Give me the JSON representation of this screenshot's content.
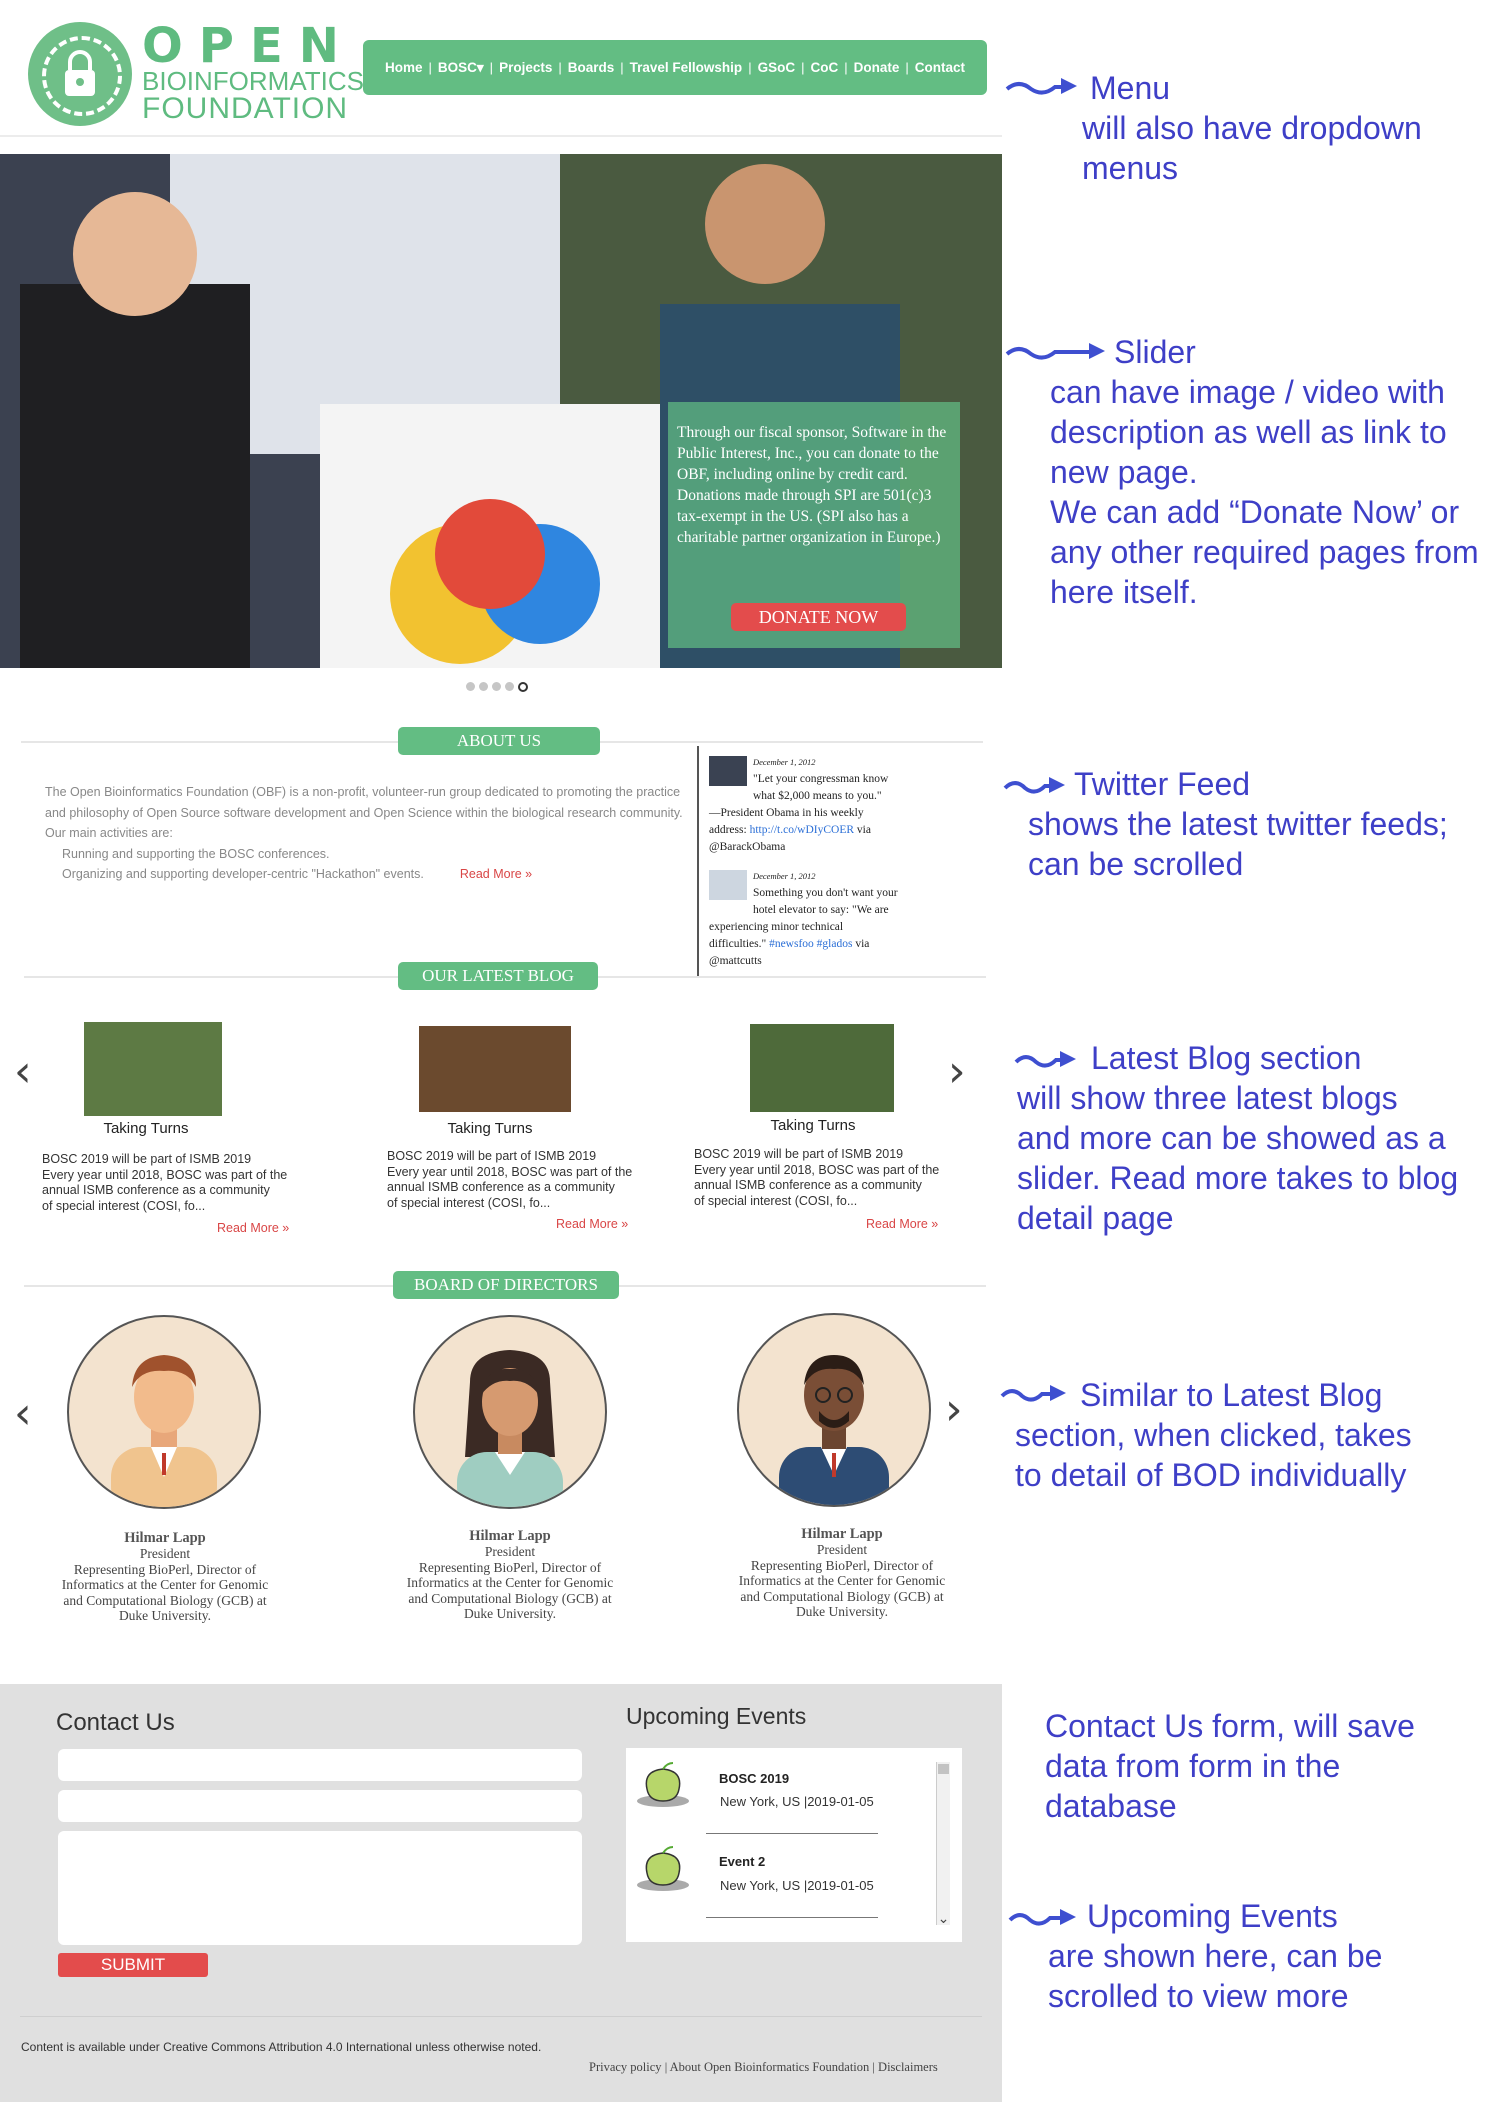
{
  "header": {
    "logo_word": "OPEN",
    "logo_line2": "BIOINFORMATICS",
    "logo_line3": "FOUNDATION",
    "menu": [
      "Home",
      "BOSC",
      "Projects",
      "Boards",
      "Travel Fellowship",
      "GSoC",
      "CoC",
      "Donate",
      "Contact"
    ],
    "menu_dropdown_marker": "▾"
  },
  "slider": {
    "caption": "Through our fiscal sponsor, Software in the Public Interest, Inc., you can donate to the OBF, including online by credit card. Donations made through SPI are 501(c)3 tax-exempt in the US. (SPI also has a charitable partner organization in Europe.)",
    "cta": "DONATE NOW",
    "dot_count": 5,
    "active_dot": 5
  },
  "about": {
    "heading": "ABOUT US",
    "para": "The Open Bioinformatics Foundation (OBF) is a non-profit, volunteer-run group dedicated to promoting the practice and philosophy of Open Source software development and Open Science within the biological research community.",
    "activities_label": "Our main activities are:",
    "activity_1": "Running and supporting the BOSC conferences.",
    "activity_2": "Organizing and supporting developer-centric \"Hackathon\" events.",
    "read_more": "Read More »"
  },
  "twitter": {
    "t1_date": "December 1, 2012",
    "t1_line1": "\"Let your congressman know",
    "t1_line2": "what $2,000 means to you.\"",
    "t1_line3": "—President Obama in his weekly",
    "t1_line4_pre": "address: ",
    "t1_link": "http://t.co/wDIyCOER",
    "t1_line4_post": " via",
    "t1_handle": "@BarackObama",
    "t2_date": "December 1, 2012",
    "t2_line1": "Something you don't want your",
    "t2_line2": "hotel elevator to say: \"We are",
    "t2_line3": "experiencing minor technical",
    "t2_line4_pre": "difficulties.\" ",
    "t2_tag1": "#newsfoo",
    "t2_tag2": "#glados",
    "t2_line4_post": " via",
    "t2_handle": "@mattcutts"
  },
  "blog": {
    "heading": "OUR LATEST BLOG",
    "posts": [
      {
        "title": "Taking Turns",
        "l1": "BOSC 2019 will be part of ISMB 2019",
        "l2": "Every year until 2018, BOSC was part of the",
        "l3": "annual ISMB conference as a community",
        "l4": "of special interest (COSI, fo...",
        "read_more": "Read More »"
      },
      {
        "title": "Taking Turns",
        "l1": "BOSC 2019 will be part of ISMB 2019",
        "l2": "Every year until 2018, BOSC was part of the",
        "l3": "annual ISMB conference as a community",
        "l4": "of special interest (COSI, fo...",
        "read_more": "Read More »"
      },
      {
        "title": "Taking Turns",
        "l1": "BOSC 2019 will be part of ISMB 2019",
        "l2": "Every year until 2018, BOSC was part of the",
        "l3": "annual ISMB conference as a community",
        "l4": "of special interest (COSI, fo...",
        "read_more": "Read More »"
      }
    ]
  },
  "board": {
    "heading": "BOARD OF DIRECTORS",
    "members": [
      {
        "name": "Hilmar Lapp",
        "role": "President",
        "d1": "Representing BioPerl, Director of",
        "d2": "Informatics at the Center for Genomic",
        "d3": "and Computational Biology (GCB) at",
        "d4": "Duke University."
      },
      {
        "name": "Hilmar Lapp",
        "role": "President",
        "d1": "Representing BioPerl, Director of",
        "d2": "Informatics at the Center for Genomic",
        "d3": "and Computational Biology (GCB) at",
        "d4": "Duke University."
      },
      {
        "name": "Hilmar Lapp",
        "role": "President",
        "d1": "Representing BioPerl, Director of",
        "d2": "Informatics at the Center for Genomic",
        "d3": "and Computational Biology (GCB) at",
        "d4": "Duke University."
      }
    ]
  },
  "contact": {
    "title": "Contact Us",
    "submit": "SUBMIT"
  },
  "events": {
    "title": "Upcoming Events",
    "items": [
      {
        "name": "BOSC 2019",
        "location": "New York, US",
        "date": "|2019-01-05"
      },
      {
        "name": "Event 2",
        "location": "New York, US",
        "date": "|2019-01-05"
      }
    ],
    "scroll_down_glyph": "⌄"
  },
  "footer": {
    "license": "Content is available under Creative Commons Attribution 4.0 International unless otherwise noted.",
    "links": [
      "Privacy policy",
      "About Open Bioinformatics Foundation",
      "Disclaimers"
    ]
  },
  "annotations": {
    "menu": [
      "Menu",
      "will also have dropdown",
      "menus"
    ],
    "slider": [
      "Slider",
      "can have image / video with",
      "description as well as link to",
      "new page.",
      "We can add “Donate Now’ or",
      "any other required pages from",
      "here itself."
    ],
    "twitter": [
      "Twitter Feed",
      "shows the latest twitter feeds;",
      "can be scrolled"
    ],
    "blog": [
      "Latest Blog section",
      "will show three latest blogs",
      "and more can be showed as a",
      "slider. Read more takes to blog",
      "detail page"
    ],
    "board": [
      "Similar to Latest Blog",
      "section, when clicked, takes",
      "to detail of BOD individually"
    ],
    "contact": [
      "Contact Us form, will save",
      "data from form in the",
      "database"
    ],
    "events": [
      "Upcoming Events",
      "are shown here, can be",
      "scrolled to view more"
    ]
  },
  "colors": {
    "brand_green": "#63bd83",
    "accent_red": "#e34c4c",
    "annotation_blue": "#3e3fc7"
  }
}
